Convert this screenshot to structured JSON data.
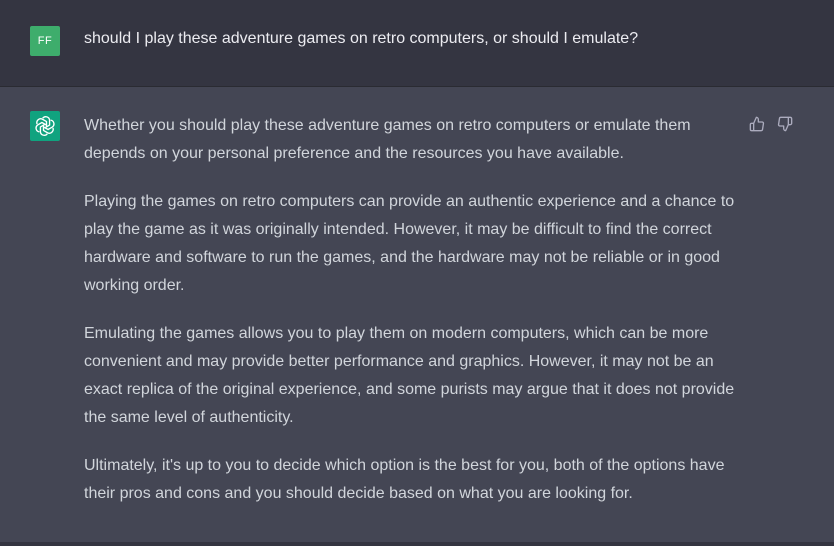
{
  "colors": {
    "user_avatar_bg": "#3ead6c",
    "assistant_avatar_bg": "#10a37f",
    "user_row_bg": "#343541",
    "assistant_row_bg": "#444654"
  },
  "user_message": {
    "avatar_initials": "FF",
    "text": "should I play these adventure games on retro computers, or should I emulate?"
  },
  "assistant_message": {
    "avatar_icon": "openai-logo-icon",
    "paragraphs": [
      "Whether you should play these adventure games on retro computers or emulate them depends on your personal preference and the resources you have available.",
      "Playing the games on retro computers can provide an authentic experience and a chance to play the game as it was originally intended. However, it may be difficult to find the correct hardware and software to run the games, and the hardware may not be reliable or in good working order.",
      "Emulating the games allows you to play them on modern computers, which can be more convenient and may provide better performance and graphics. However, it may not be an exact replica of the original experience, and some purists may argue that it does not provide the same level of authenticity.",
      "Ultimately, it's up to you to decide which option is the best for you, both of the options have their pros and cons and you should decide based on what you are looking for."
    ],
    "feedback_icons": [
      "thumbs-up-icon",
      "thumbs-down-icon"
    ]
  }
}
